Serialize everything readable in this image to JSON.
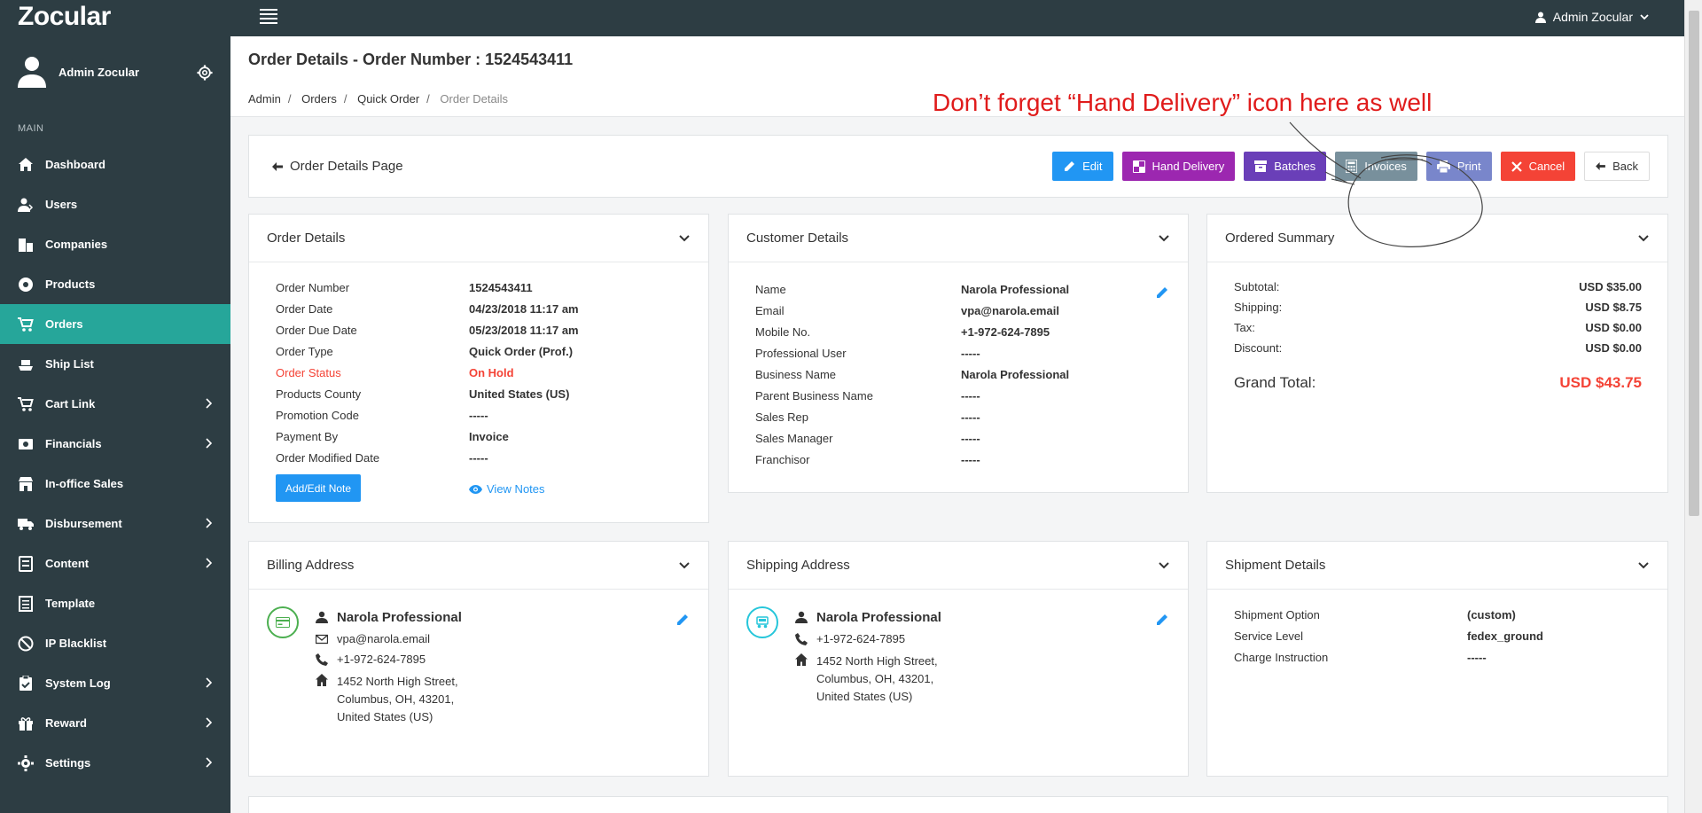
{
  "app": {
    "brand": "Zocular",
    "user_menu": "Admin Zocular"
  },
  "sidebar": {
    "profile_name": "Admin Zocular",
    "section": "MAIN",
    "items": [
      {
        "label": "Dashboard",
        "icon": "home-icon",
        "has_children": false,
        "active": false
      },
      {
        "label": "Users",
        "icon": "users-icon",
        "has_children": false,
        "active": false
      },
      {
        "label": "Companies",
        "icon": "building-icon",
        "has_children": false,
        "active": false
      },
      {
        "label": "Products",
        "icon": "products-icon",
        "has_children": false,
        "active": false
      },
      {
        "label": "Orders",
        "icon": "cart-icon",
        "has_children": false,
        "active": true
      },
      {
        "label": "Ship List",
        "icon": "ship-icon",
        "has_children": false,
        "active": false
      },
      {
        "label": "Cart Link",
        "icon": "cart-link-icon",
        "has_children": true,
        "active": false
      },
      {
        "label": "Financials",
        "icon": "money-icon",
        "has_children": true,
        "active": false
      },
      {
        "label": "In-office Sales",
        "icon": "store-icon",
        "has_children": false,
        "active": false
      },
      {
        "label": "Disbursement",
        "icon": "truck-icon",
        "has_children": true,
        "active": false
      },
      {
        "label": "Content",
        "icon": "content-icon",
        "has_children": true,
        "active": false
      },
      {
        "label": "Template",
        "icon": "template-icon",
        "has_children": false,
        "active": false
      },
      {
        "label": "IP Blacklist",
        "icon": "ban-icon",
        "has_children": false,
        "active": false
      },
      {
        "label": "System Log",
        "icon": "clipboard-icon",
        "has_children": true,
        "active": false
      },
      {
        "label": "Reward",
        "icon": "gift-icon",
        "has_children": true,
        "active": false
      },
      {
        "label": "Settings",
        "icon": "cog-icon",
        "has_children": true,
        "active": false
      }
    ]
  },
  "header": {
    "title": "Order Details - Order Number : 1524543411",
    "breadcrumb": [
      "Admin",
      "Orders",
      "Quick Order",
      "Order Details"
    ]
  },
  "annotation": "Don’t forget “Hand Delivery” icon here as well",
  "actions": {
    "page_label": "Order Details Page",
    "edit": "Edit",
    "hand_delivery": "Hand Delivery",
    "batches": "Batches",
    "invoices": "Invoices",
    "print": "Print",
    "cancel": "Cancel",
    "back": "Back"
  },
  "order_details": {
    "title": "Order Details",
    "rows": [
      {
        "k": "Order Number",
        "v": "1524543411"
      },
      {
        "k": "Order Date",
        "v": "04/23/2018 11:17 am"
      },
      {
        "k": "Order Due Date",
        "v": "05/23/2018 11:17 am"
      },
      {
        "k": "Order Type",
        "v": "Quick Order (Prof.)"
      },
      {
        "k": "Order Status",
        "v": "On Hold"
      },
      {
        "k": "Products County",
        "v": "United States (US)"
      },
      {
        "k": "Promotion Code",
        "v": "-----"
      },
      {
        "k": "Payment By",
        "v": "Invoice"
      },
      {
        "k": "Order Modified Date",
        "v": "-----"
      }
    ],
    "note_button": "Add/Edit Note",
    "view_notes": "View Notes"
  },
  "customer_details": {
    "title": "Customer Details",
    "rows": [
      {
        "k": "Name",
        "v": "Narola Professional"
      },
      {
        "k": "Email",
        "v": "vpa@narola.email"
      },
      {
        "k": "Mobile No.",
        "v": "+1-972-624-7895"
      },
      {
        "k": "Professional User",
        "v": "-----"
      },
      {
        "k": "Business Name",
        "v": "Narola Professional"
      },
      {
        "k": "Parent Business Name",
        "v": "-----"
      },
      {
        "k": "Sales Rep",
        "v": "-----"
      },
      {
        "k": "Sales Manager",
        "v": "-----"
      },
      {
        "k": "Franchisor",
        "v": "-----"
      }
    ]
  },
  "ordered_summary": {
    "title": "Ordered Summary",
    "rows": [
      {
        "k": "Subtotal:",
        "v": "USD $35.00"
      },
      {
        "k": "Shipping:",
        "v": "USD $8.75"
      },
      {
        "k": "Tax:",
        "v": "USD $0.00"
      },
      {
        "k": "Discount:",
        "v": "USD $0.00"
      }
    ],
    "grand_total_label": "Grand Total:",
    "grand_total": "USD $43.75"
  },
  "billing": {
    "title": "Billing Address",
    "name": "Narola Professional",
    "email": "vpa@narola.email",
    "phone": "+1-972-624-7895",
    "address": [
      "1452 North High Street,",
      "Columbus, OH, 43201,",
      "United States (US)"
    ]
  },
  "shipping": {
    "title": "Shipping Address",
    "name": "Narola Professional",
    "phone": "+1-972-624-7895",
    "address": [
      "1452 North High Street,",
      "Columbus, OH, 43201,",
      "United States (US)"
    ]
  },
  "shipment": {
    "title": "Shipment Details",
    "rows": [
      {
        "k": "Shipment Option",
        "v": "(custom)"
      },
      {
        "k": "Service Level",
        "v": "fedex_ground"
      },
      {
        "k": "Charge Instruction",
        "v": "-----"
      }
    ]
  },
  "colors": {
    "sidebar": "#2d3d43",
    "active": "#26a69a",
    "primary": "#2196f3",
    "hand_delivery": "#9c27b0",
    "danger": "#f44336"
  }
}
